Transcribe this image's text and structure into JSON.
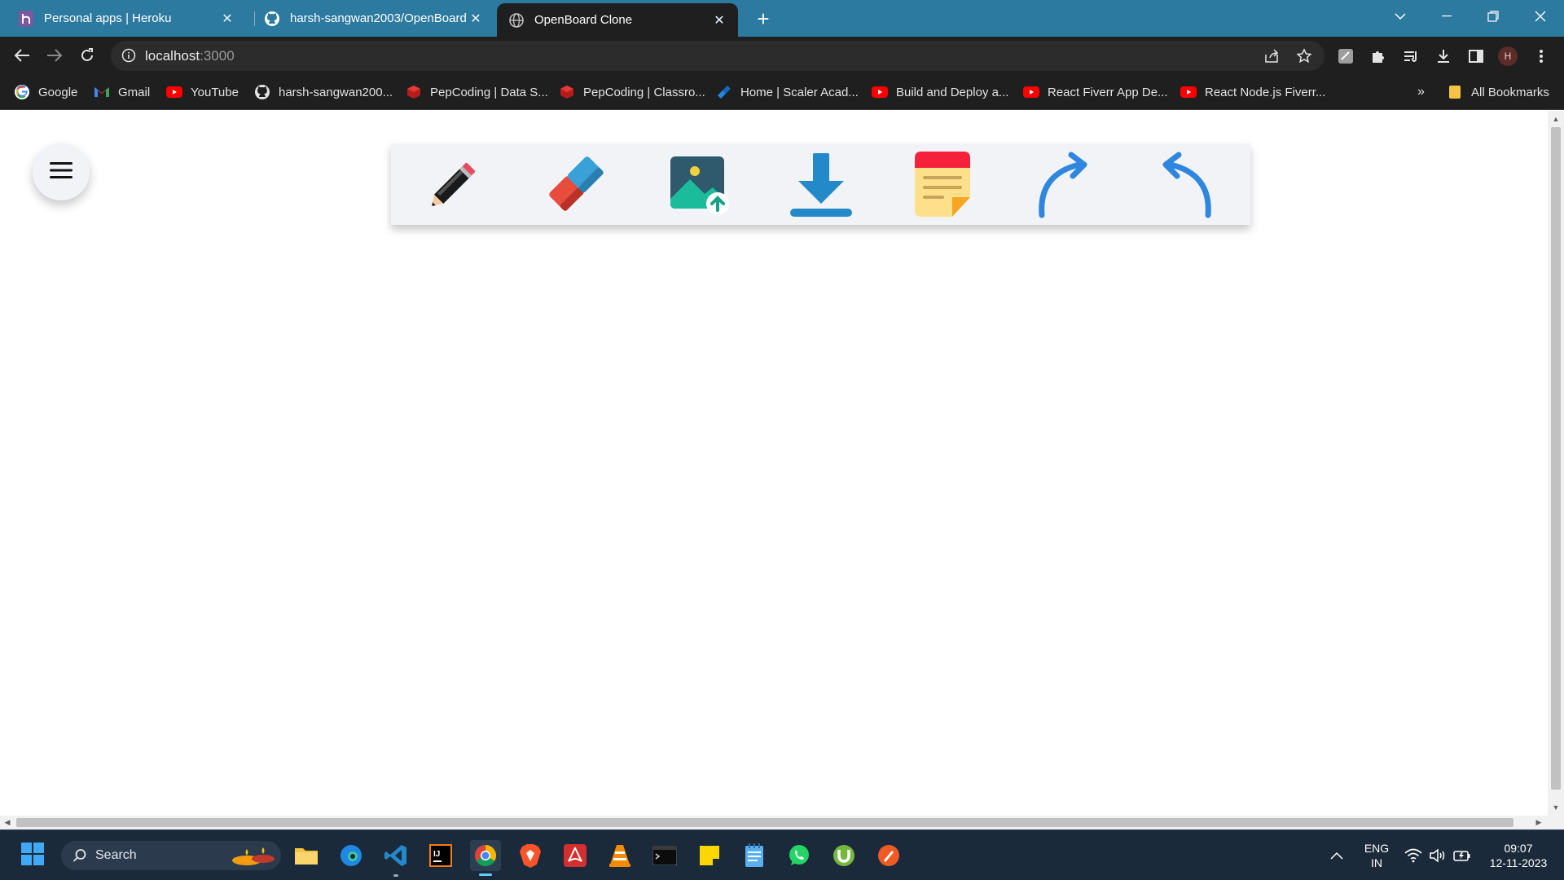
{
  "browser": {
    "tabs": [
      {
        "title": "Personal apps | Heroku",
        "favicon": "heroku-icon",
        "active": false
      },
      {
        "title": "harsh-sangwan2003/OpenBoard",
        "favicon": "github-icon",
        "active": false
      },
      {
        "title": "OpenBoard Clone",
        "favicon": "globe-icon",
        "active": true
      }
    ],
    "new_tab_label": "+",
    "url_host": "localhost",
    "url_port": ":3000",
    "profile_initial": "H"
  },
  "bookmarks": {
    "items": [
      {
        "label": "Google",
        "icon": "google-icon"
      },
      {
        "label": "Gmail",
        "icon": "gmail-icon"
      },
      {
        "label": "YouTube",
        "icon": "youtube-icon"
      },
      {
        "label": "harsh-sangwan200...",
        "icon": "github-icon"
      },
      {
        "label": "PepCoding | Data S...",
        "icon": "pepcoding-icon"
      },
      {
        "label": "PepCoding | Classro...",
        "icon": "pepcoding-icon"
      },
      {
        "label": "Home | Scaler Acad...",
        "icon": "scaler-icon"
      },
      {
        "label": "Build and Deploy a...",
        "icon": "youtube-icon"
      },
      {
        "label": "React Fiverr App De...",
        "icon": "youtube-icon"
      },
      {
        "label": "React Node.js Fiverr...",
        "icon": "youtube-icon"
      }
    ],
    "overflow_label": "»",
    "all_bookmarks_label": "All Bookmarks"
  },
  "app": {
    "menu_icon": "hamburger-icon",
    "tools": [
      "pencil-icon",
      "eraser-icon",
      "upload-image-icon",
      "download-icon",
      "sticky-note-icon",
      "redo-icon",
      "undo-icon"
    ]
  },
  "taskbar": {
    "search_label": "Search",
    "language_top": "ENG",
    "language_bottom": "IN",
    "time": "09:07",
    "date": "12-11-2023"
  },
  "colors": {
    "tabstrip": "#2c7aa0",
    "chrome_dark": "#1f1f1f",
    "tool_blue": "#2e86de",
    "toolbox_bg": "#f1f3f6",
    "taskbar": "#1b2a3a"
  }
}
